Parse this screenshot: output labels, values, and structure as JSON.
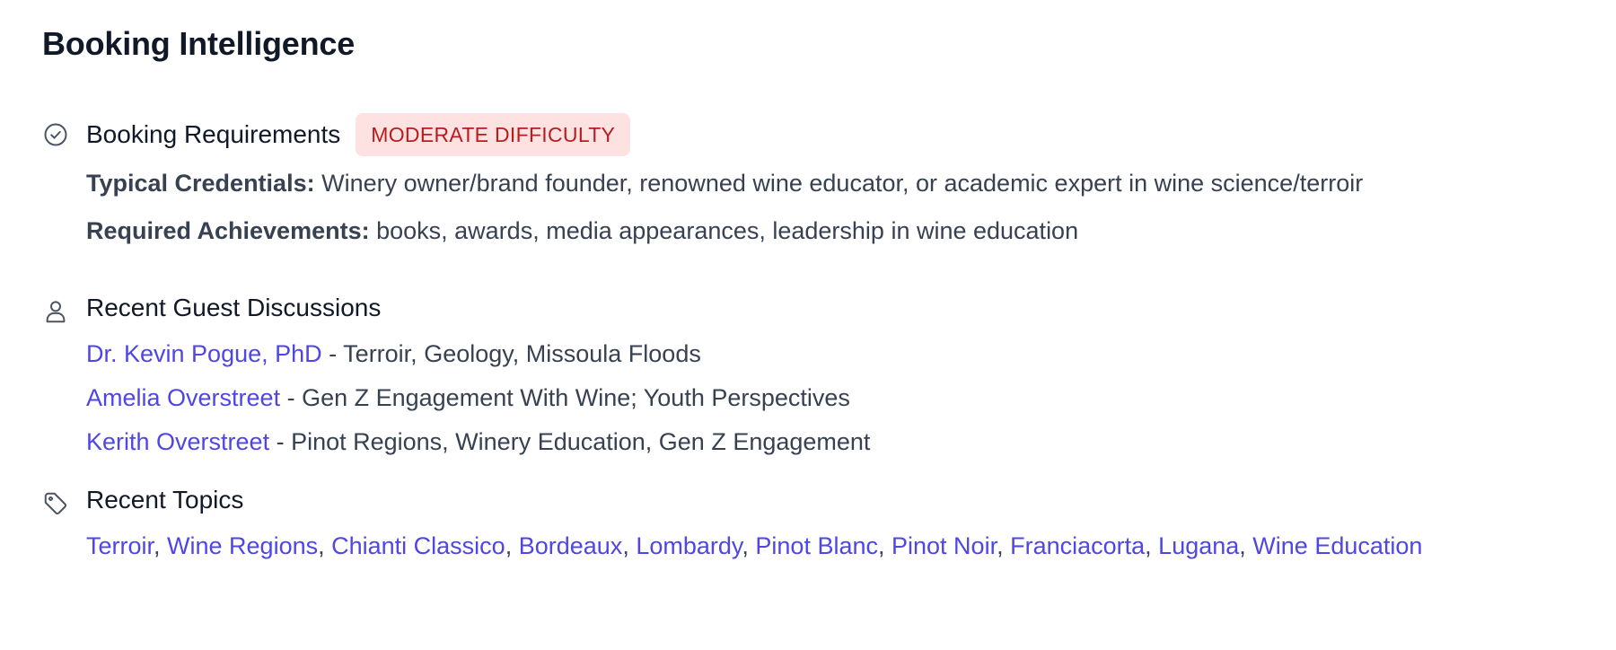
{
  "page": {
    "title": "Booking Intelligence"
  },
  "requirements": {
    "title": "Booking Requirements",
    "badge": "MODERATE DIFFICULTY",
    "credentials_label": "Typical Credentials:",
    "credentials_value": "Winery owner/brand founder, renowned wine educator, or academic expert in wine science/terroir",
    "achievements_label": "Required Achievements:",
    "achievements_value": "books, awards, media appearances, leadership in wine education",
    "icon": "check-circle-icon"
  },
  "guests": {
    "title": "Recent Guest Discussions",
    "icon": "user-icon",
    "items": [
      {
        "name": "Dr. Kevin Pogue, PhD",
        "sep": " - ",
        "topics": "Terroir, Geology, Missoula Floods"
      },
      {
        "name": "Amelia Overstreet",
        "sep": " - ",
        "topics": "Gen Z Engagement With Wine; Youth Perspectives"
      },
      {
        "name": "Kerith Overstreet",
        "sep": " - ",
        "topics": "Pinot Regions, Winery Education, Gen Z Engagement"
      }
    ]
  },
  "topics": {
    "title": "Recent Topics",
    "icon": "tag-icon",
    "separator": ", ",
    "items": [
      "Terroir",
      "Wine Regions",
      "Chianti Classico",
      "Bordeaux",
      "Lombardy",
      "Pinot Blanc",
      "Pinot Noir",
      "Franciacorta",
      "Lugana",
      "Wine Education"
    ]
  },
  "colors": {
    "link": "#4f46e5",
    "badge_bg": "#fde2e1",
    "badge_text": "#b91c1c",
    "text": "#374151",
    "heading": "#111827"
  }
}
